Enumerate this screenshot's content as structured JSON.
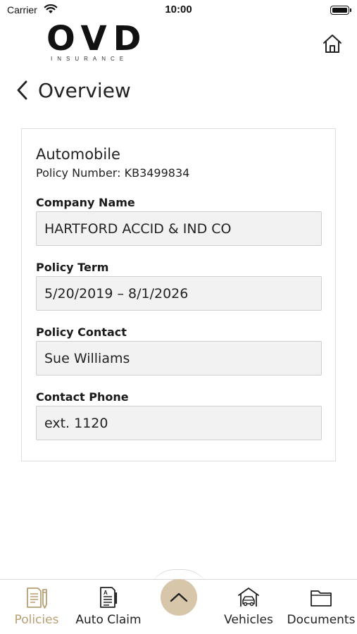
{
  "status_bar": {
    "carrier": "Carrier",
    "time": "10:00"
  },
  "header": {
    "logo_main": "OVD",
    "logo_sub": "INSURANCE",
    "home_icon": "home-icon"
  },
  "nav": {
    "back_icon": "chevron-left-icon",
    "title": "Overview"
  },
  "policy": {
    "type": "Automobile",
    "number_label": "Policy Number:",
    "number": "KB3499834",
    "fields": [
      {
        "label": "Company Name",
        "value": "HARTFORD ACCID & IND CO"
      },
      {
        "label": "Policy Term",
        "value": "5/20/2019 – 8/1/2026"
      },
      {
        "label": "Policy Contact",
        "value": "Sue Williams"
      },
      {
        "label": "Contact Phone",
        "value": "ext. 1120"
      }
    ]
  },
  "tab_bar": {
    "accent_color": "#b89e72",
    "center_button_color": "#d8c6aa",
    "center_icon": "chevron-up-icon",
    "tabs": [
      {
        "label": "Policies",
        "icon": "policy-document-icon",
        "active": true
      },
      {
        "label": "Auto Claim",
        "icon": "claim-form-icon",
        "active": false
      },
      {
        "label": "Vehicles",
        "icon": "car-garage-icon",
        "active": false
      },
      {
        "label": "Documents",
        "icon": "folder-icon",
        "active": false
      }
    ]
  }
}
